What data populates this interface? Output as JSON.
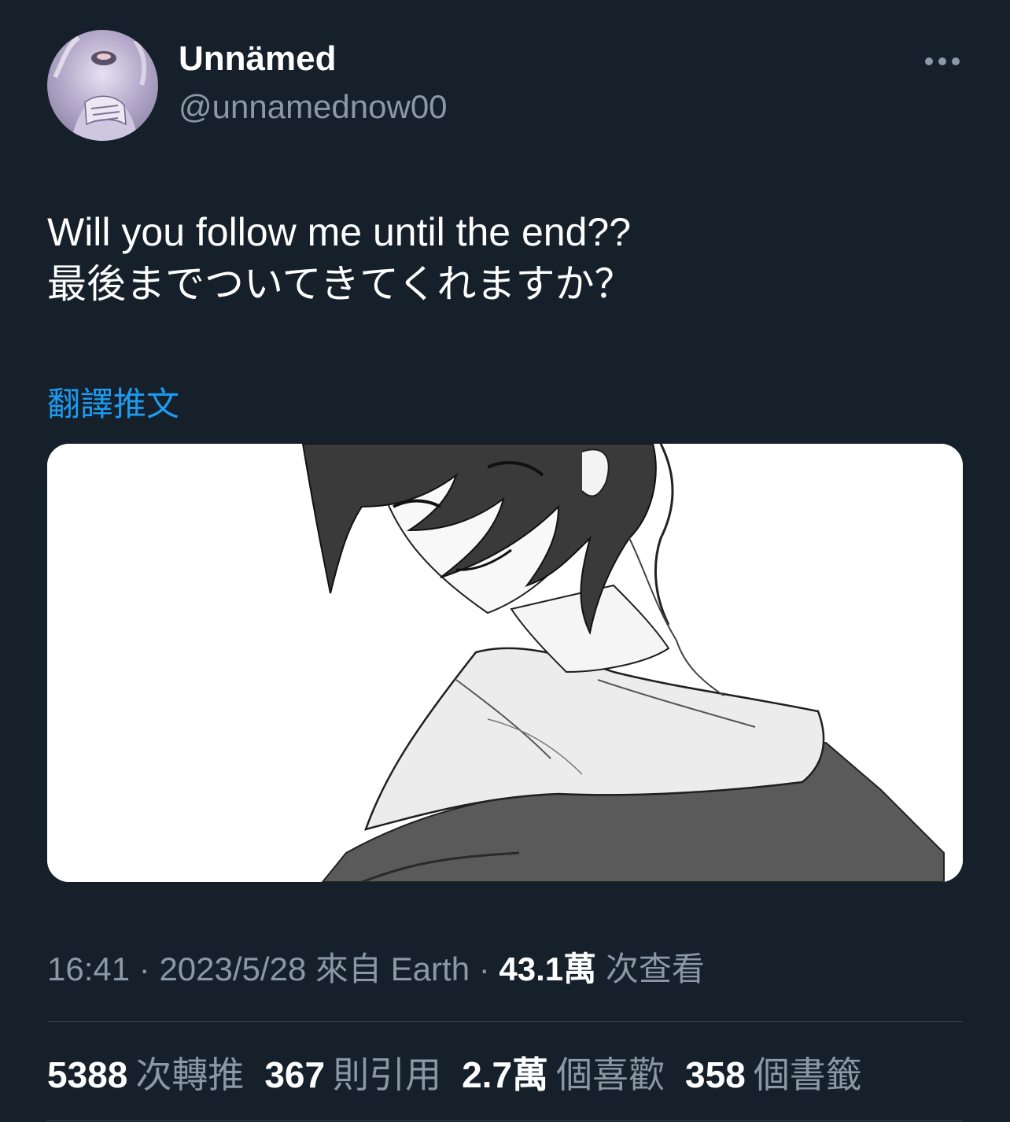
{
  "author": {
    "display_name": "Unnämed",
    "handle": "@unnamednow00"
  },
  "tweet": {
    "text_line1": "Will you follow me until the end??",
    "text_line2": "最後までついてきてくれますか？",
    "translate_label": "翻譯推文"
  },
  "meta": {
    "time": "16:41",
    "date": "2023/5/28",
    "source_prefix": "來自",
    "source": "Earth",
    "separator": "·",
    "views_count": "43.1萬",
    "views_label": "次查看"
  },
  "stats": [
    {
      "count": "5388",
      "label": "次轉推"
    },
    {
      "count": "367",
      "label": "則引用"
    },
    {
      "count": "2.7萬",
      "label": "個喜歡"
    },
    {
      "count": "358",
      "label": "個書籤"
    }
  ],
  "icons": {
    "more": "more-horizontal-icon"
  },
  "colors": {
    "background": "#15202b",
    "primary_text": "#ffffff",
    "secondary_text": "#8b98a5",
    "link": "#1d9bf0",
    "divider": "#38444d"
  }
}
